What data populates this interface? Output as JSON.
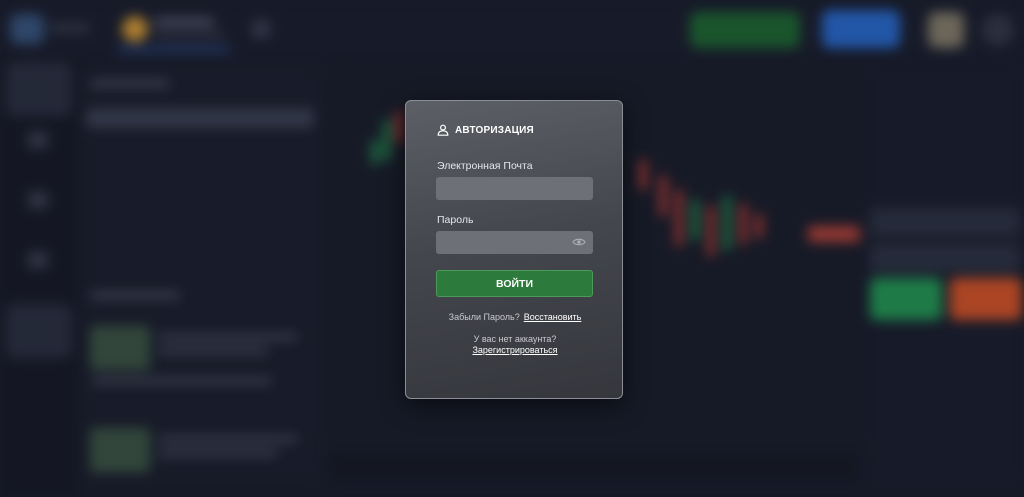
{
  "modal": {
    "title": "АВТОРИЗАЦИЯ",
    "email_label": "Электронная Почта",
    "email_value": "",
    "password_label": "Пароль",
    "password_value": "",
    "login_button": "ВОЙТИ",
    "forgot_text": "Забыли Пароль?",
    "restore_link": "Восстановить",
    "no_account_text": "У вас нет аккаунта?",
    "register_link": "Зарегистрироваться",
    "icons": {
      "header": "user-icon",
      "password_toggle": "eye-icon"
    }
  },
  "colors": {
    "login_button": "#2c7a3c",
    "buy": "#24a15a",
    "sell": "#e0582a",
    "accent": "#2a6fd9"
  }
}
